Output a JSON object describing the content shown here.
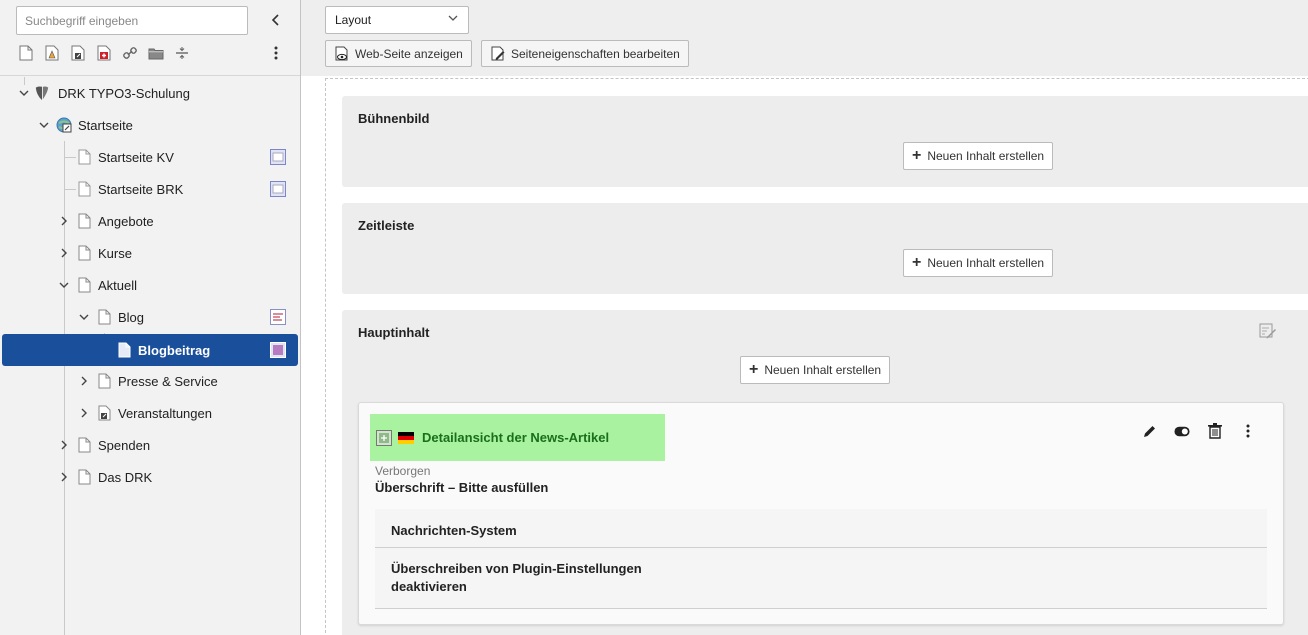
{
  "tree": {
    "search_placeholder": "Suchbegriff eingeben",
    "items": [
      {
        "label": "DRK TYPO3-Schulung"
      },
      {
        "label": "Startseite"
      },
      {
        "label": "Startseite KV"
      },
      {
        "label": "Startseite BRK"
      },
      {
        "label": "Angebote"
      },
      {
        "label": "Kurse"
      },
      {
        "label": "Aktuell"
      },
      {
        "label": "Blog"
      },
      {
        "label": "Blogbeitrag"
      },
      {
        "label": "Presse & Service"
      },
      {
        "label": "Veranstaltungen"
      },
      {
        "label": "Spenden"
      },
      {
        "label": "Das DRK"
      }
    ]
  },
  "docheader": {
    "layout_value": "Layout",
    "view_button": "Web-Seite anzeigen",
    "edit_page_button": "Seiteneigenschaften bearbeiten"
  },
  "columns": [
    {
      "title": "Bühnenbild",
      "new_label": "Neuen Inhalt erstellen"
    },
    {
      "title": "Zeitleiste",
      "new_label": "Neuen Inhalt erstellen"
    },
    {
      "title": "Hauptinhalt",
      "new_label": "Neuen Inhalt erstellen"
    }
  ],
  "content_element": {
    "title": "Detailansicht der News-Artikel",
    "status": "Verborgen",
    "header": "Überschrift – Bitte ausfüllen",
    "rows": [
      {
        "label": "Nachrichten-System"
      },
      {
        "label": "Überschreiben von Plugin-Einstellungen",
        "label2": "deaktivieren"
      }
    ]
  },
  "colors": {
    "selected_bg": "#1a4f9c",
    "ce_header_bg": "#a8f2a0",
    "ce_title": "#1a6f1a"
  }
}
